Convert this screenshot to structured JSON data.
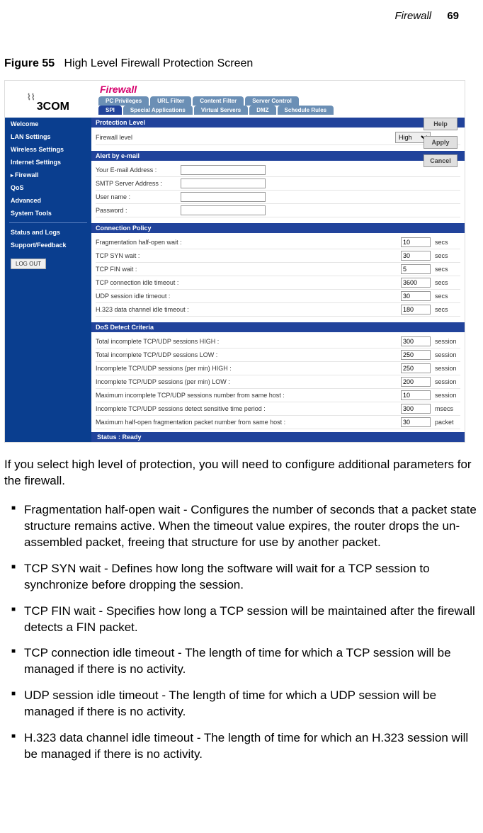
{
  "page_header": {
    "section": "Firewall",
    "number": "69"
  },
  "figure": {
    "label": "Figure 55",
    "caption": "High Level Firewall Protection Screen"
  },
  "screenshot": {
    "logo_text": "3COM",
    "nav": {
      "items": [
        "Welcome",
        "LAN Settings",
        "Wireless Settings",
        "Internet Settings",
        "Firewall",
        "QoS",
        "Advanced",
        "System Tools"
      ],
      "group2": [
        "Status and Logs",
        "Support/Feedback"
      ],
      "logout": "LOG OUT"
    },
    "title": "Firewall",
    "tabs_top": [
      "PC Privileges",
      "URL Filter",
      "Content Filter",
      "Server Control"
    ],
    "tabs_bottom": [
      "SPI",
      "Special Applications",
      "Virtual Servers",
      "DMZ",
      "Schedule Rules"
    ],
    "buttons": {
      "help": "Help",
      "apply": "Apply",
      "cancel": "Cancel"
    },
    "sections": {
      "protection": {
        "heading": "Protection Level",
        "row_label": "Firewall level",
        "value": "High"
      },
      "alert": {
        "heading": "Alert by e-mail",
        "rows": [
          {
            "label": "Your E-mail Address :",
            "value": ""
          },
          {
            "label": "SMTP Server Address :",
            "value": ""
          },
          {
            "label": "User name :",
            "value": ""
          },
          {
            "label": "Password :",
            "value": ""
          }
        ]
      },
      "connpolicy": {
        "heading": "Connection Policy",
        "rows": [
          {
            "label": "Fragmentation half-open wait :",
            "value": "10",
            "unit": "secs"
          },
          {
            "label": "TCP SYN wait :",
            "value": "30",
            "unit": "secs"
          },
          {
            "label": "TCP FIN wait :",
            "value": "5",
            "unit": "secs"
          },
          {
            "label": "TCP connection idle timeout :",
            "value": "3600",
            "unit": "secs"
          },
          {
            "label": "UDP session idle timeout :",
            "value": "30",
            "unit": "secs"
          },
          {
            "label": "H.323 data channel idle timeout :",
            "value": "180",
            "unit": "secs"
          }
        ]
      },
      "dos": {
        "heading": "DoS Detect Criteria",
        "rows": [
          {
            "label": "Total incomplete TCP/UDP sessions HIGH :",
            "value": "300",
            "unit": "session"
          },
          {
            "label": "Total incomplete TCP/UDP sessions LOW :",
            "value": "250",
            "unit": "session"
          },
          {
            "label": "Incomplete TCP/UDP sessions (per min) HIGH :",
            "value": "250",
            "unit": "session"
          },
          {
            "label": "Incomplete TCP/UDP sessions (per min) LOW :",
            "value": "200",
            "unit": "session"
          },
          {
            "label": "Maximum incomplete TCP/UDP sessions number from same host :",
            "value": "10",
            "unit": "session"
          },
          {
            "label": "Incomplete TCP/UDP sessions detect sensitive time period :",
            "value": "300",
            "unit": "msecs"
          },
          {
            "label": "Maximum half-open fragmentation packet number from same host :",
            "value": "30",
            "unit": "packet"
          }
        ]
      }
    },
    "status": "Status : Ready"
  },
  "paragraph": "If you select high level of protection, you will need to configure additional parameters for the firewall.",
  "bullets": [
    "Fragmentation half-open wait - Configures the number of seconds that a packet state structure remains active. When the timeout value expires, the router drops the un-assembled packet, freeing that structure for use by another packet.",
    "TCP SYN wait - Defines how long the software will wait for a TCP session to synchronize before dropping the session.",
    "TCP FIN wait - Specifies how long a TCP session will be maintained after the firewall detects a FIN packet.",
    "TCP connection idle timeout - The length of time for which a TCP session will be managed if there is no activity.",
    "UDP session idle timeout - The length of time for which a UDP session will be managed if there is no activity.",
    "H.323 data channel idle timeout - The length of time for which an H.323 session will be managed if there is no activity."
  ]
}
